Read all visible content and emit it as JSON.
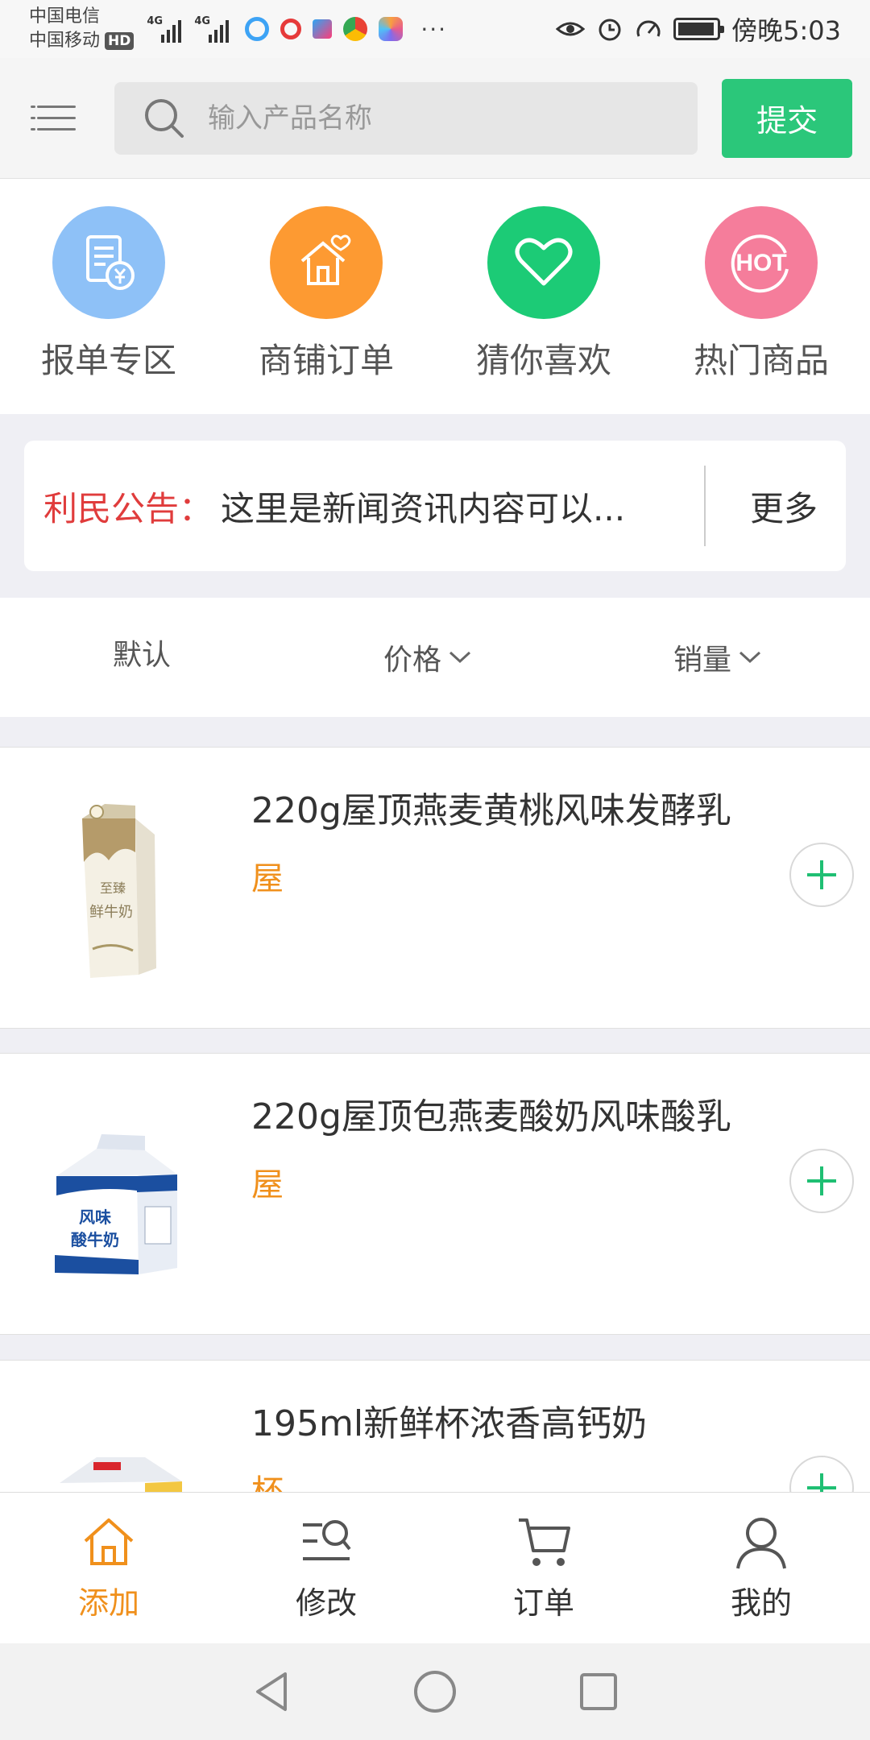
{
  "status_bar": {
    "carrier1": "中国电信",
    "carrier2": "中国移动",
    "hd": "HD",
    "net1": "4G",
    "net2": "4G",
    "time": "傍晚5:03",
    "more": "···"
  },
  "header": {
    "search_placeholder": "输入产品名称",
    "submit_label": "提交"
  },
  "categories": [
    {
      "label": "报单专区",
      "icon": "document-yen-icon",
      "color": "#8ec1f7"
    },
    {
      "label": "商铺订单",
      "icon": "house-heart-icon",
      "color": "#fd9a32"
    },
    {
      "label": "猜你喜欢",
      "icon": "heart-icon",
      "color": "#1ccb76"
    },
    {
      "label": "热门商品",
      "icon": "hot-icon",
      "color": "#f57d9b"
    }
  ],
  "notice": {
    "tag": "利民公告：",
    "text": "这里是新闻资讯内容可以...",
    "more": "更多"
  },
  "sort": {
    "default": "默认",
    "price": "价格",
    "sales": "销量"
  },
  "products": [
    {
      "name": "220g屋顶燕麦黄桃风味发酵乳",
      "unit": "屋"
    },
    {
      "name": "220g屋顶包燕麦酸奶风味酸乳",
      "unit": "屋"
    },
    {
      "name": "195ml新鲜杯浓香高钙奶",
      "unit": "杯"
    }
  ],
  "tabs": [
    {
      "label": "添加",
      "icon": "home-icon"
    },
    {
      "label": "修改",
      "icon": "edit-search-icon"
    },
    {
      "label": "订单",
      "icon": "cart-icon"
    },
    {
      "label": "我的",
      "icon": "user-icon"
    }
  ],
  "colors": {
    "accent_green": "#2bc77a",
    "accent_orange": "#f0901c",
    "notice_red": "#e03c3c"
  }
}
